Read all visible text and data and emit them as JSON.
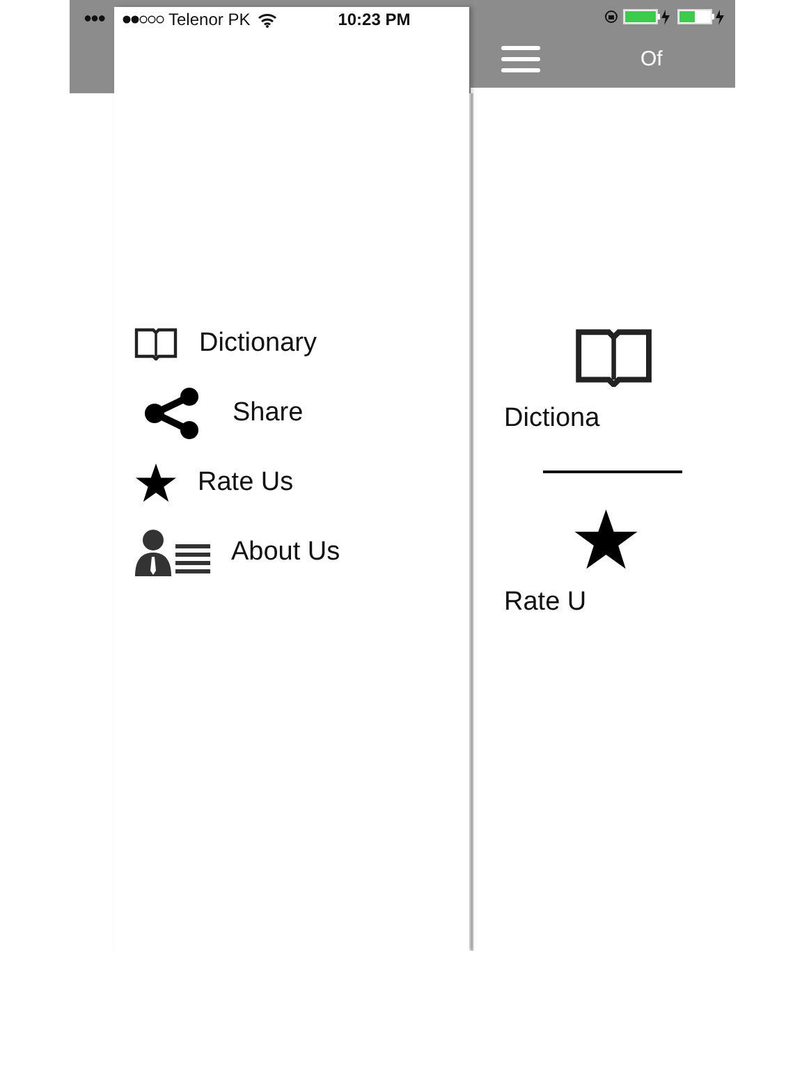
{
  "underlay": {
    "carrier_dots": "●●●",
    "header": {
      "title": "Of"
    },
    "home_items": [
      {
        "kind": "book",
        "label": "Dictiona"
      },
      {
        "kind": "star",
        "label": "Rate U"
      }
    ]
  },
  "drawer": {
    "status_bar": {
      "carrier": "Telenor PK",
      "time": "10:23 PM"
    },
    "menu": [
      {
        "kind": "book",
        "label": "Dictionary"
      },
      {
        "kind": "share",
        "label": "Share"
      },
      {
        "kind": "star",
        "label": "Rate Us"
      },
      {
        "kind": "about",
        "label": "About Us"
      }
    ]
  }
}
